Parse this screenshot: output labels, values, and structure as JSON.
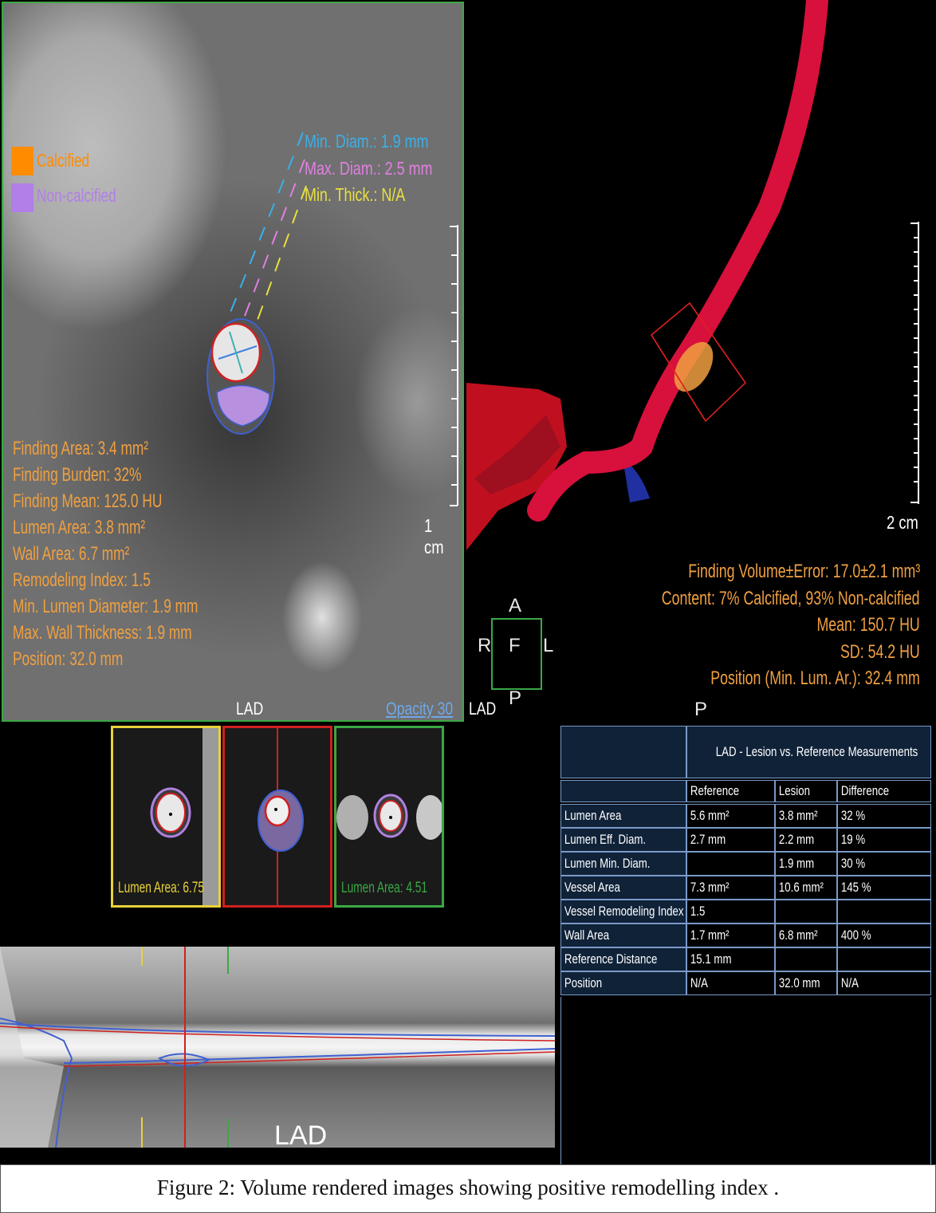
{
  "ct_view": {
    "legend": [
      {
        "label": "Calcified",
        "color": "#ff8c00"
      },
      {
        "label": "Non-calcified",
        "color": "#b27ee8"
      }
    ],
    "measurements": {
      "min_diam": "Min. Diam.: 1.9 mm",
      "max_diam": "Max. Diam.: 2.5 mm",
      "min_thick": "Min. Thick.: N/A"
    },
    "findings": [
      "Finding Area: 3.4 mm²",
      "Finding Burden: 32%",
      "Finding Mean: 125.0 HU",
      "Lumen Area: 3.8 mm²",
      "Wall Area: 6.7 mm²",
      "Remodeling Index: 1.5",
      "Min. Lumen Diameter: 1.9 mm",
      "Max. Wall Thickness: 1.9 mm",
      "Position:  32.0 mm"
    ],
    "scale": "1 cm",
    "vessel": "LAD",
    "opacity_label": "Opacity",
    "opacity_value": "30",
    "orientation_right": "R"
  },
  "vr_view": {
    "scale": "2 cm",
    "vessel": "LAD",
    "info": [
      "Finding Volume±Error: 17.0±2.1 mm³",
      "Content: 7% Calcified, 93% Non-calcified",
      "Mean: 150.7 HU",
      "SD: 54.2 HU",
      "Position (Min. Lum. Ar.): 32.4 mm"
    ],
    "orientation_cube": {
      "top": "A",
      "left": "R",
      "center": "F",
      "right": "L",
      "bottom": "P"
    },
    "bottom_label": "P"
  },
  "thumbnails": [
    {
      "label": "Lumen Area: 6.75",
      "border": "#e8d23a"
    },
    {
      "label": "",
      "border": "#d02020"
    },
    {
      "label": "Lumen Area: 4.51",
      "border": "#3aa845"
    }
  ],
  "mpr": {
    "vessel": "LAD"
  },
  "table": {
    "title": "LAD - Lesion vs. Reference Measurements",
    "columns": [
      "Reference",
      "Lesion",
      "Difference"
    ],
    "rows": [
      {
        "label": "Lumen Area",
        "reference": "5.6 mm²",
        "lesion": "3.8 mm²",
        "difference": "32 %"
      },
      {
        "label": "Lumen Eff. Diam.",
        "reference": "2.7 mm",
        "lesion": "2.2 mm",
        "difference": "19 %"
      },
      {
        "label": "Lumen Min. Diam.",
        "reference": "",
        "lesion": "1.9 mm",
        "difference": "30 %"
      },
      {
        "label": "Vessel Area",
        "reference": "7.3 mm²",
        "lesion": "10.6 mm²",
        "difference": "145 %"
      },
      {
        "label": "Vessel Remodeling Index",
        "reference": "1.5",
        "lesion": "",
        "difference": ""
      },
      {
        "label": "Wall Area",
        "reference": "1.7 mm²",
        "lesion": "6.8 mm²",
        "difference": "400 %"
      },
      {
        "label": "Reference Distance",
        "reference": "15.1 mm",
        "lesion": "",
        "difference": ""
      },
      {
        "label": "Position",
        "reference": "N/A",
        "lesion": "32.0 mm",
        "difference": "N/A"
      }
    ]
  },
  "caption": "Figure 2: Volume rendered images showing positive remodelling index ."
}
